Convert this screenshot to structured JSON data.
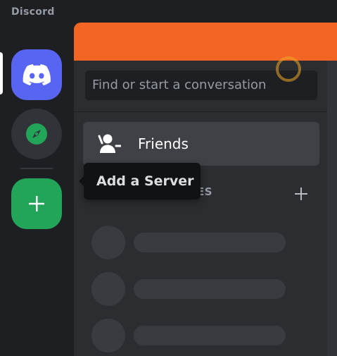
{
  "app": {
    "wordmark": "Discord"
  },
  "server_rail": {
    "home_icon": "discord-logo-icon",
    "explore_icon": "compass-icon",
    "add_icon": "plus-icon"
  },
  "tooltip": {
    "text": "Add a Server"
  },
  "dm_panel": {
    "search_placeholder": "Find or start a conversation",
    "friends_label": "Friends",
    "friends_icon": "person-wave-icon",
    "dm_header_visible": "ES",
    "dm_add_icon": "plus-icon"
  },
  "colors": {
    "brand": "#5865f2",
    "green": "#23a559",
    "banner": "#f26522",
    "rail_bg": "#1e1f22",
    "panel_bg": "#2b2d31"
  }
}
